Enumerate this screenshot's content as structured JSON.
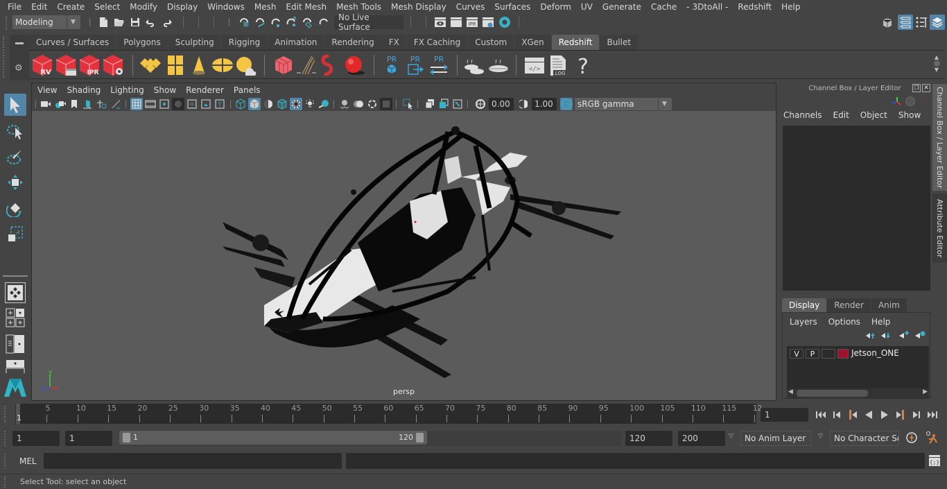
{
  "menubar": {
    "items": [
      "File",
      "Edit",
      "Create",
      "Select",
      "Modify",
      "Display",
      "Windows",
      "Mesh",
      "Edit Mesh",
      "Mesh Tools",
      "Mesh Display",
      "Curves",
      "Surfaces",
      "Deform",
      "UV",
      "Generate",
      "Cache",
      "- 3DtoAll -",
      "Redshift",
      "Help"
    ]
  },
  "statusline": {
    "workspace_mode": "Modeling",
    "live_surface": "No Live Surface",
    "icons": [
      "new-scene-icon",
      "open-scene-icon",
      "save-scene-icon",
      "undo-icon",
      "redo-icon",
      "snap-grid-icon",
      "snap-curve-icon",
      "snap-point-icon",
      "snap-view-plane-icon",
      "snap-live-icon",
      "snap-surface-icon",
      "render-view-icon",
      "render-frame-icon",
      "ipr-render-icon",
      "render-settings-icon",
      "hypershade-icon"
    ],
    "right_icons": [
      "modeling-toolkit-icon",
      "attribute-editor-toggle-icon",
      "tool-settings-toggle-icon",
      "channel-box-toggle-icon"
    ]
  },
  "shelf": {
    "tabs": [
      "Curves / Surfaces",
      "Polygons",
      "Sculpting",
      "Rigging",
      "Animation",
      "Rendering",
      "FX",
      "FX Caching",
      "Custom",
      "XGen",
      "Redshift",
      "Bullet"
    ],
    "active_tab": "Redshift",
    "icon_labels": {
      "rv": "RV",
      "ipr": "IPR",
      "pr": "PR",
      "log": ".LOG",
      "help": "?"
    }
  },
  "panel": {
    "menus": [
      "View",
      "Shading",
      "Lighting",
      "Show",
      "Renderer",
      "Panels"
    ],
    "exposure": "0.00",
    "gamma": "1.00",
    "color_space": "sRGB gamma",
    "camera_label": "persp",
    "axis_labels": {
      "x": "x",
      "y": "y",
      "z": "z"
    }
  },
  "channel_box": {
    "title": "Channel Box / Layer Editor",
    "menus": [
      "Channels",
      "Edit",
      "Object",
      "Show"
    ]
  },
  "layer_editor": {
    "tabs": [
      "Display",
      "Render",
      "Anim"
    ],
    "active_tab": "Display",
    "menus": [
      "Layers",
      "Options",
      "Help"
    ],
    "layers": [
      {
        "visible": "V",
        "playback": "P",
        "type": "",
        "color": "#a0102a",
        "name": "Jetson_ONE"
      }
    ]
  },
  "side_tabs": [
    "Channel Box / Layer Editor",
    "Attribute Editor"
  ],
  "timeline": {
    "start_label": "1",
    "ticks": [
      "5",
      "10",
      "15",
      "20",
      "25",
      "30",
      "35",
      "40",
      "45",
      "50",
      "55",
      "60",
      "65",
      "70",
      "75",
      "80",
      "85",
      "90",
      "95",
      "100",
      "105",
      "110",
      "115",
      "12"
    ],
    "current_frame": "1",
    "playback_buttons": [
      "go-to-start-icon",
      "step-back-icon",
      "step-back-key-icon",
      "play-backward-icon",
      "play-forward-icon",
      "step-forward-key-icon",
      "step-forward-icon",
      "go-to-end-icon"
    ]
  },
  "range": {
    "start": "1",
    "playback_start": "1",
    "slider_start": "1",
    "slider_end": "120",
    "playback_end": "120",
    "end": "200",
    "anim_layer": "No Anim Layer",
    "character_set": "No Character Set"
  },
  "command_line": {
    "language": "MEL",
    "input": "",
    "output": ""
  },
  "help_line": {
    "text": "Select Tool: select an object"
  }
}
